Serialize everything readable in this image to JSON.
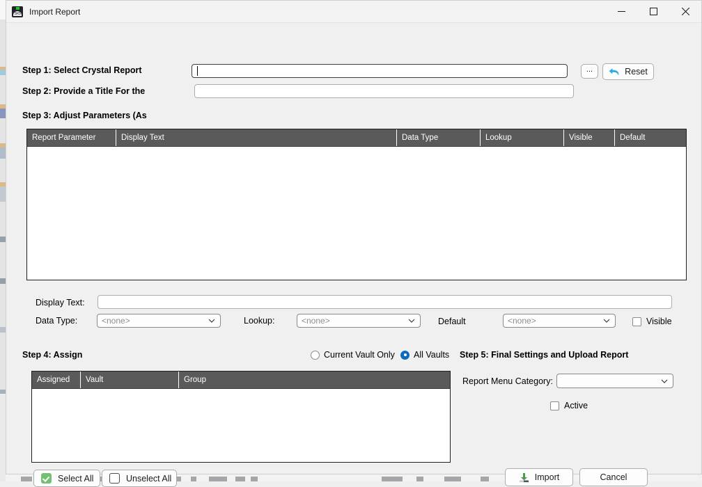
{
  "window": {
    "title": "Import Report",
    "icon": "app-dome-icon",
    "controls": {
      "minimize": "minimize-icon",
      "maximize": "maximize-icon",
      "close": "close-icon"
    }
  },
  "step1": {
    "label": "Step 1:  Select Crystal Report",
    "path_value": "",
    "path_placeholder": "",
    "browse_label": "...",
    "reset_label": "Reset",
    "reset_icon": "undo-arrow-icon",
    "reset_icon_color": "#29aae2"
  },
  "step2": {
    "label": "Step 2:  Provide a Title For the",
    "title_value": "",
    "title_placeholder": ""
  },
  "step3": {
    "label": "Step 3:  Adjust Parameters (As",
    "grid": {
      "columns": [
        "Report Parameter",
        "Display Text",
        "Data Type",
        "Lookup",
        "Visible",
        "Default"
      ],
      "rows": []
    },
    "detail": {
      "display_text_label": "Display Text:",
      "display_text_value": "",
      "data_type_label": "Data Type:",
      "data_type_value": "<none>",
      "lookup_label": "Lookup:",
      "lookup_value": "<none>",
      "default_label": "Default",
      "default_value": "<none>",
      "visible_label": "Visible",
      "visible_checked": false
    }
  },
  "step4": {
    "label": "Step 4:  Assign",
    "scope_options": [
      {
        "label": "Current Vault Only",
        "selected": false
      },
      {
        "label": "All Vaults",
        "selected": true
      }
    ],
    "grid": {
      "columns": [
        "Assigned",
        "Vault",
        "Group"
      ],
      "rows": []
    },
    "select_all_label": "Select All",
    "select_all_icon": "checked-checkbox-icon",
    "unselect_all_label": "Unselect All",
    "unselect_all_icon": "empty-checkbox-icon"
  },
  "step5": {
    "label": "Step 5:  Final Settings and Upload Report",
    "category_label": "Report Menu Category:",
    "category_value": "",
    "active_label": "Active",
    "active_checked": false
  },
  "footer": {
    "import_label": "Import",
    "import_icon": "download-arrow-icon",
    "cancel_label": "Cancel"
  },
  "colors": {
    "grid_header_bg": "#5a5a5a",
    "dialog_bg": "#f0f0f0",
    "accent_blue": "#0f6cbd",
    "icon_green": "#73bf73",
    "reset_blue": "#29aae2"
  }
}
